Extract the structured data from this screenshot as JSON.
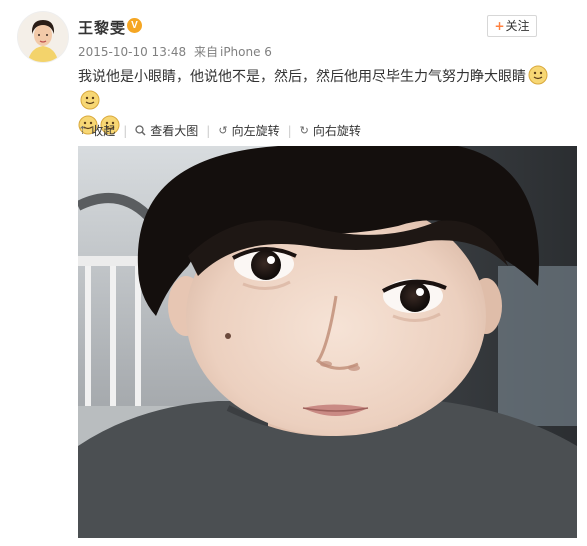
{
  "user": {
    "name": "王黎雯",
    "verified_mark": "V"
  },
  "follow_button": {
    "icon": "plus-icon",
    "label": "关注"
  },
  "meta": {
    "date": "2015-10-10 13:48",
    "source_prefix": "来自",
    "source": "iPhone 6"
  },
  "post": {
    "text": "我说他是小眼睛，他说他不是，然后，然后他用尽毕生力气努力睁大眼睛",
    "emoji_names": [
      "smile-emoji-icon",
      "smile-emoji-icon",
      "smile-emoji-icon",
      "smile-emoji-icon"
    ]
  },
  "actions": [
    {
      "icon": "collapse-arrow-icon",
      "label": "收起"
    },
    {
      "icon": "magnifier-icon",
      "label": "查看大图"
    },
    {
      "icon": "rotate-left-icon",
      "label": "向左旋转"
    },
    {
      "icon": "rotate-right-icon",
      "label": "向右旋转"
    }
  ],
  "colors": {
    "badge": "#f5a623",
    "follow_plus": "#ff8140",
    "meta_text": "#808080"
  }
}
